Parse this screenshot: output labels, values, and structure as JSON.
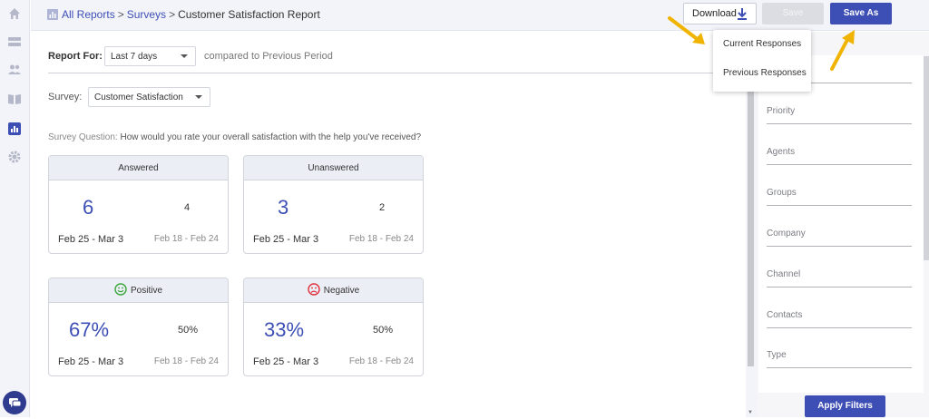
{
  "breadcrumb": {
    "all_reports": "All Reports",
    "separator": ">",
    "surveys": "Surveys",
    "current": "Customer Satisfaction Report"
  },
  "toolbar": {
    "download_label": "Download",
    "save_label": "Save",
    "save_as_label": "Save As"
  },
  "download_menu": {
    "items": [
      "Current Responses",
      "Previous Responses"
    ]
  },
  "report": {
    "report_for_label": "Report For:",
    "period_value": "Last 7 days",
    "compared_text": "compared to Previous Period",
    "survey_label": "Survey:",
    "survey_value": "Customer Satisfaction",
    "question_label": "Survey Question:",
    "question_text": "How would you rate your overall satisfaction with the help you've received?"
  },
  "cards": [
    {
      "title": "Answered",
      "current": "6",
      "previous": "4",
      "current_range": "Feb 25 - Mar 3",
      "previous_range": "Feb 18 - Feb 24"
    },
    {
      "title": "Unanswered",
      "current": "3",
      "previous": "2",
      "current_range": "Feb 25 - Mar 3",
      "previous_range": "Feb 18 - Feb 24"
    },
    {
      "title": "Positive",
      "icon": "smiley-icon",
      "current": "67%",
      "previous": "50%",
      "current_range": "Feb 25 - Mar 3",
      "previous_range": "Feb 18 - Feb 24"
    },
    {
      "title": "Negative",
      "icon": "frown-icon",
      "current": "33%",
      "previous": "50%",
      "current_range": "Feb 25 - Mar 3",
      "previous_range": "Feb 18 - Feb 24"
    }
  ],
  "filters": {
    "fields": [
      "Priority",
      "Agents",
      "Groups",
      "Company",
      "Channel",
      "Contacts",
      "Type"
    ],
    "apply_label": "Apply Filters"
  },
  "sidebar": {
    "icons": [
      "home-icon",
      "tickets-icon",
      "contacts-icon",
      "knowledge-base-icon",
      "reports-icon",
      "settings-icon",
      "chat-icon"
    ]
  },
  "colors": {
    "accent": "#3d4fb5",
    "positive": "#3aa63a",
    "negative": "#e0303a",
    "annotation_arrow": "#f0b400"
  }
}
